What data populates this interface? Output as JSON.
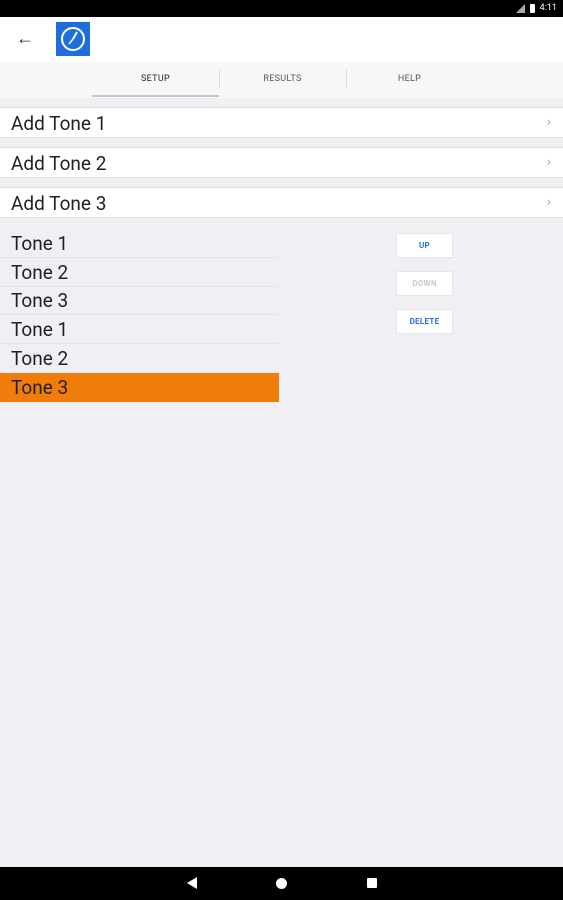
{
  "status_bar": {
    "time": "4:11"
  },
  "tabs": [
    {
      "label": "SETUP",
      "active": true
    },
    {
      "label": "RESULTS",
      "active": false
    },
    {
      "label": "HELP",
      "active": false
    }
  ],
  "add_rows": [
    {
      "label": "Add Tone 1"
    },
    {
      "label": "Add Tone 2"
    },
    {
      "label": "Add Tone 3"
    }
  ],
  "tone_list": [
    {
      "label": "Tone 1",
      "selected": false
    },
    {
      "label": "Tone 2",
      "selected": false
    },
    {
      "label": "Tone 3",
      "selected": false
    },
    {
      "label": "Tone 1",
      "selected": false
    },
    {
      "label": "Tone 2",
      "selected": false
    },
    {
      "label": "Tone 3",
      "selected": true
    }
  ],
  "side_buttons": {
    "up": {
      "label": "UP",
      "enabled": true
    },
    "down": {
      "label": "DOWN",
      "enabled": false
    },
    "delete": {
      "label": "DELETE",
      "enabled": true
    }
  },
  "colors": {
    "accent": "#2d6fe0",
    "selection": "#f07d0a",
    "logo": "#1e6fd9"
  }
}
